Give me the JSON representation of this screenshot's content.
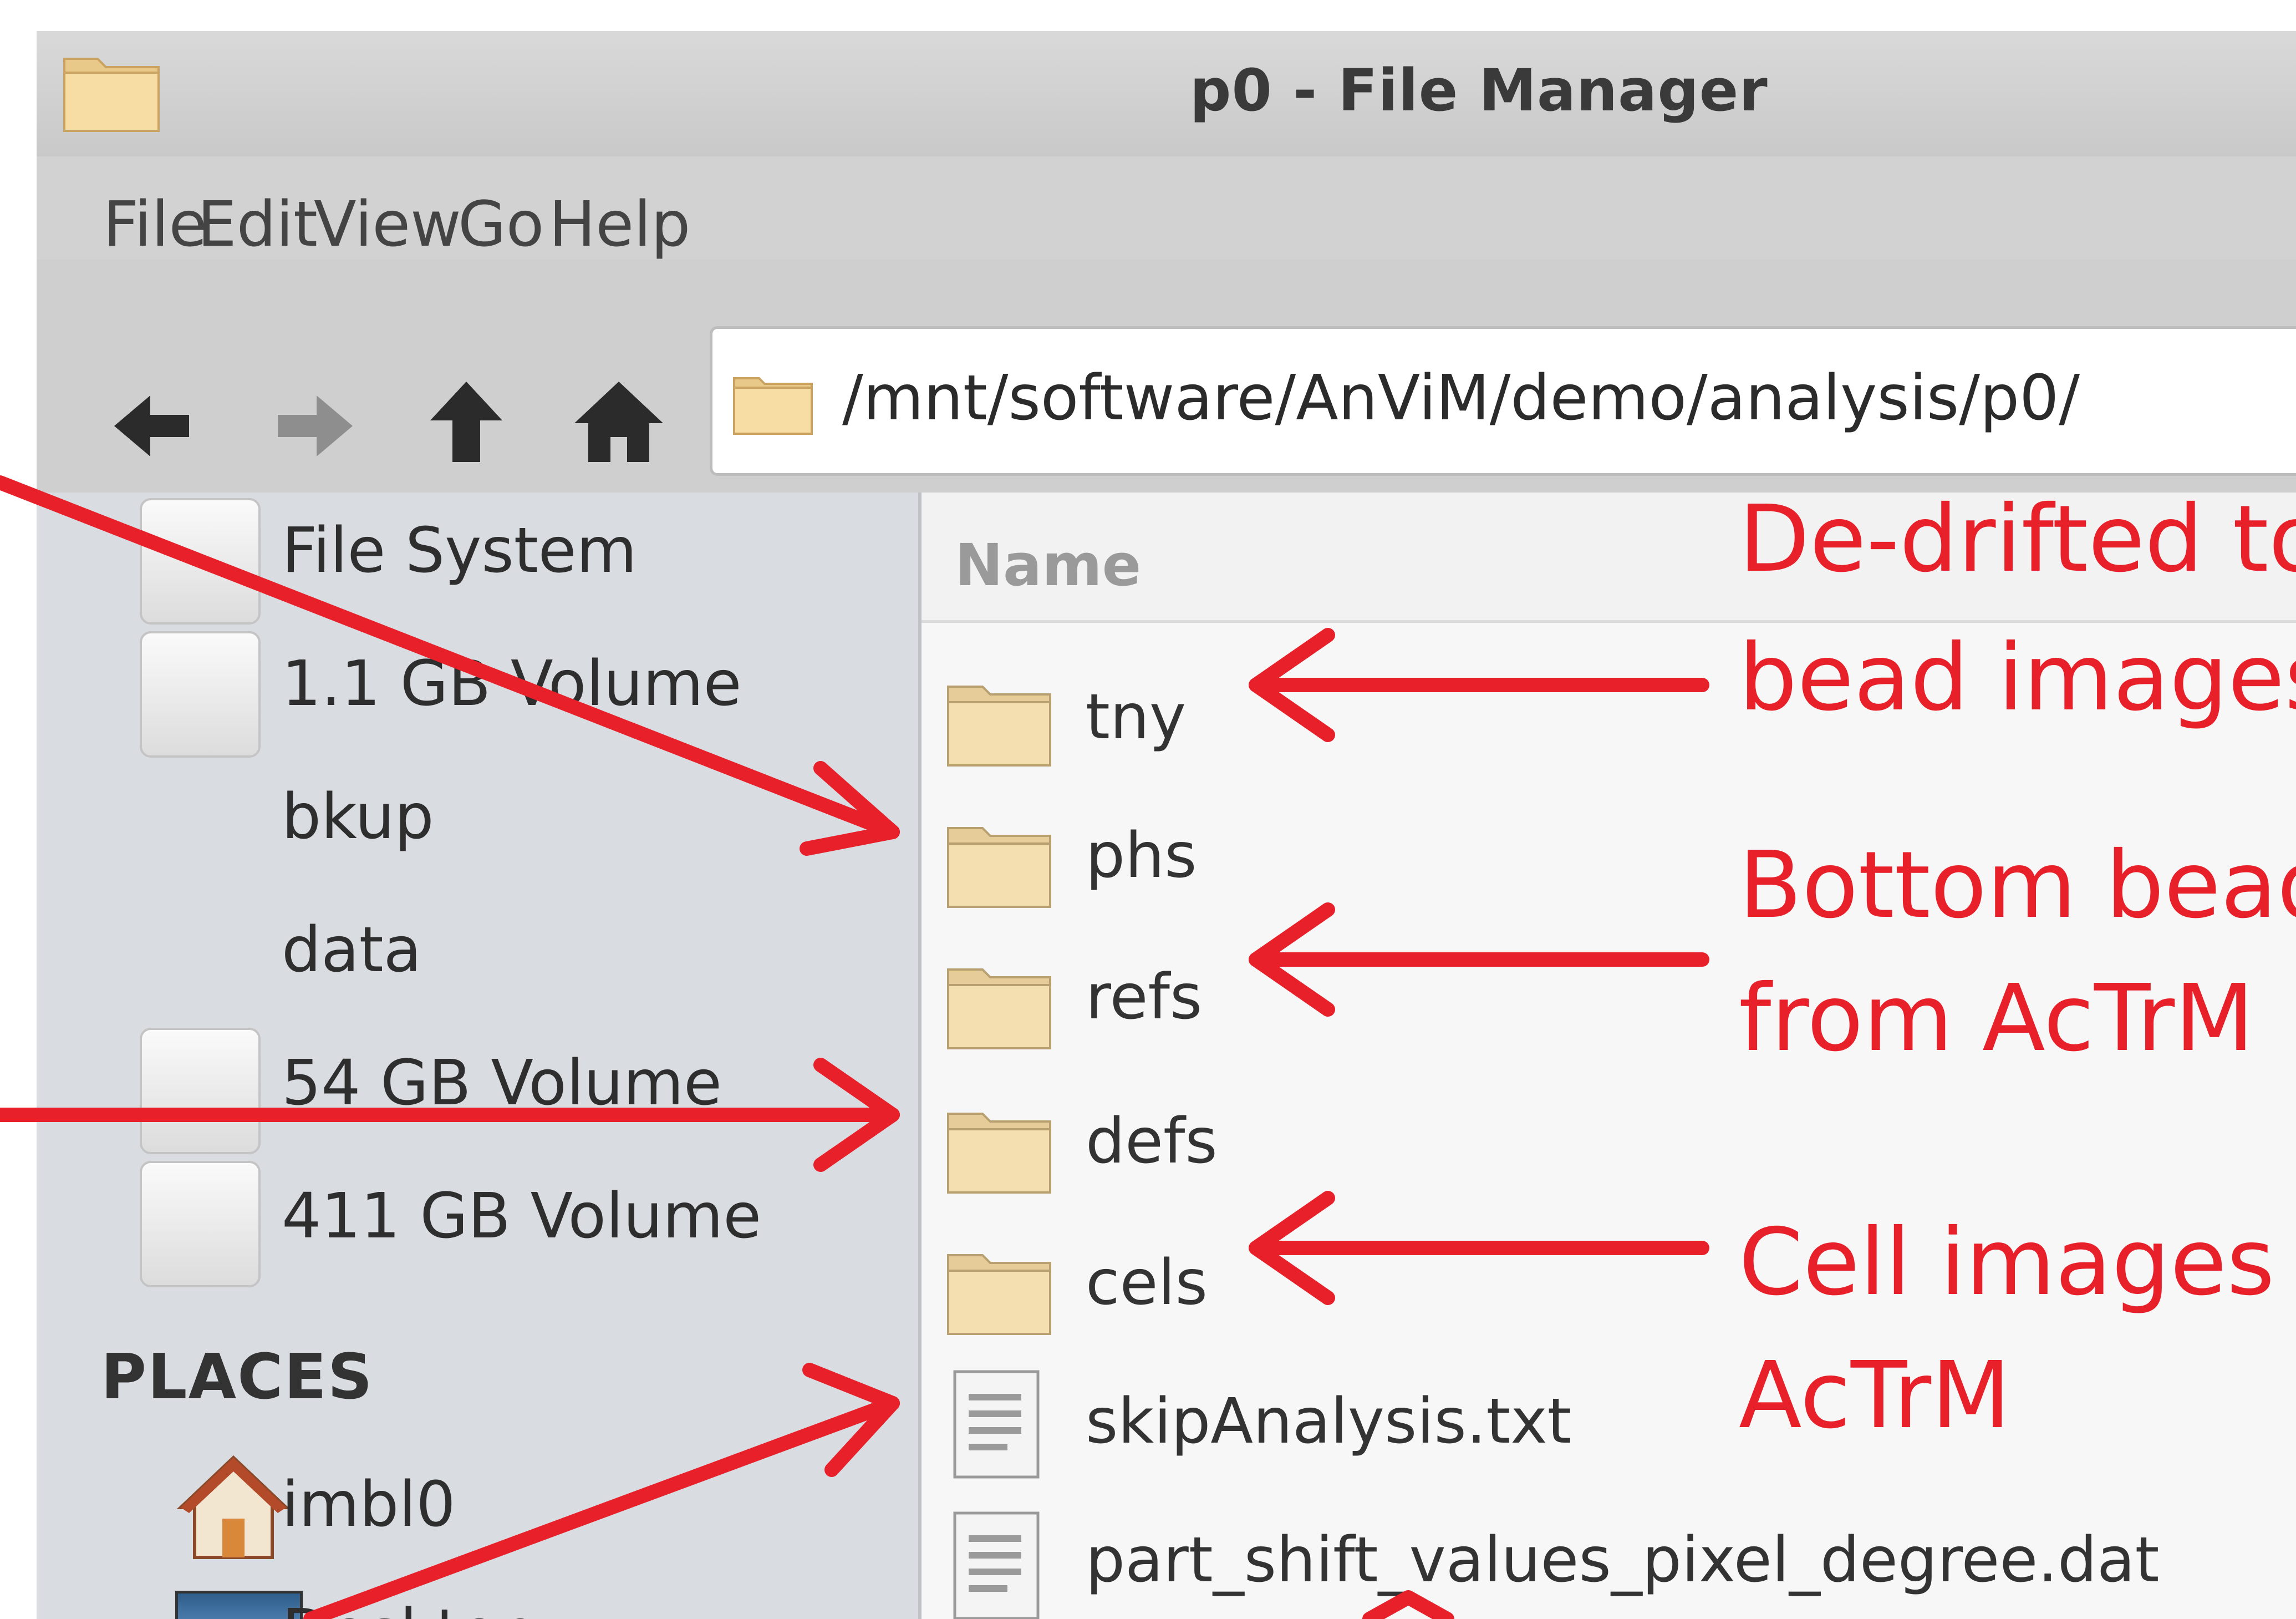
{
  "window": {
    "title": "p0 - File Manager"
  },
  "menu": [
    "File",
    "Edit",
    "View",
    "Go",
    "Help"
  ],
  "toolbar": {
    "back_icon": "arrow-left-icon",
    "forward_icon": "arrow-right-icon",
    "up_icon": "arrow-up-icon",
    "home_icon": "home-icon",
    "path": "/mnt/software/AnViM/demo/analysis/p0/"
  },
  "sidebar": {
    "devices": [
      "File System",
      "1.1 GB Volume",
      "bkup",
      "data",
      "54 GB Volume",
      "411 GB Volume"
    ],
    "places_heading": "PLACES",
    "places": [
      "imbl0",
      "Desktop"
    ]
  },
  "content": {
    "column_header": "Name",
    "files": [
      {
        "name": "tny",
        "type": "folder"
      },
      {
        "name": "phs",
        "type": "folder"
      },
      {
        "name": "refs",
        "type": "folder"
      },
      {
        "name": "defs",
        "type": "folder"
      },
      {
        "name": "cels",
        "type": "folder"
      },
      {
        "name": "skipAnalysis.txt",
        "type": "text-file"
      },
      {
        "name": "part_shift_values_pixel_degree.dat",
        "type": "text-file"
      }
    ]
  },
  "annotations": [
    "De-drifted to",
    "bead images",
    "Bottom bead",
    "from AcTrM",
    "Cell images",
    "AcTrM"
  ],
  "colors": {
    "annotation": "#e8202a",
    "folder": "#f0d59a"
  }
}
